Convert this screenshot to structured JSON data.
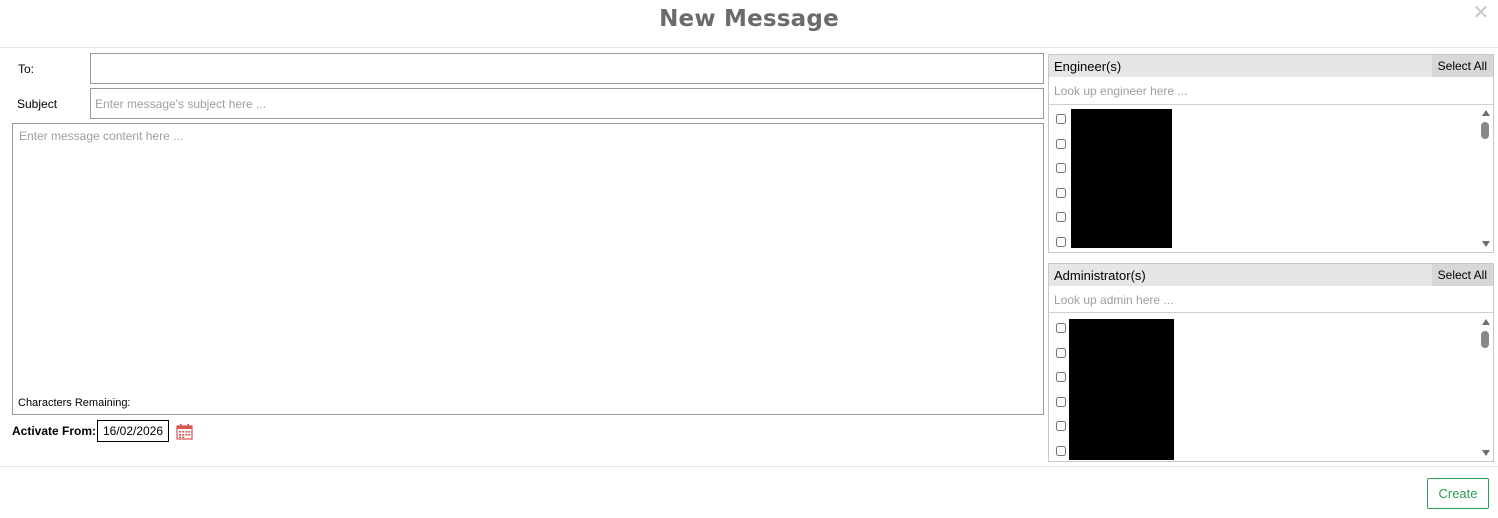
{
  "modal": {
    "title": "New Message",
    "close_icon": "close-icon"
  },
  "form": {
    "to_label": "To:",
    "to_value": "",
    "subject_label": "Subject",
    "subject_placeholder": "Enter message's subject here ...",
    "content_placeholder": "Enter message content here ...",
    "chars_remaining_label": "Characters Remaining:",
    "activate_from_label": "Activate From:",
    "activate_from_value": "16/02/2026",
    "calendar_icon": "calendar-icon"
  },
  "engineers": {
    "title": "Engineer(s)",
    "select_all_label": "Select All",
    "search_placeholder": "Look up engineer here ...",
    "visible_rows": 6
  },
  "administrators": {
    "title": "Administrator(s)",
    "select_all_label": "Select All",
    "search_placeholder": "Look up admin here ...",
    "visible_rows": 6
  },
  "footer": {
    "create_label": "Create"
  },
  "colors": {
    "title": "#6b6b6b",
    "create_accent": "#2b9a54",
    "calendar_icon": "#d9534f",
    "panel_header": "#e6e6e6",
    "select_all_bg": "#d7d7d7"
  }
}
